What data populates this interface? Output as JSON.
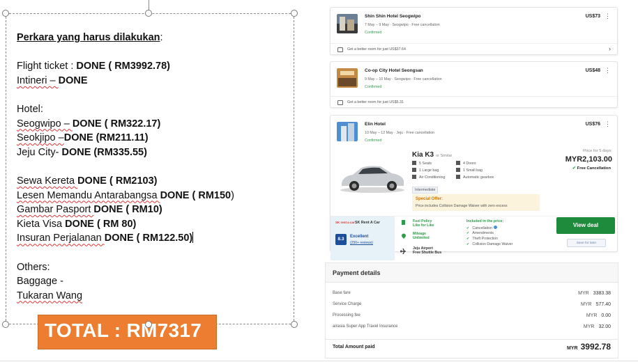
{
  "doc": {
    "heading": "Perkara yang harus dilakukan",
    "lines": [
      {
        "label": "Flight ticket : ",
        "bold": "DONE ( RM3992.78)"
      },
      {
        "label": "Intineri – ",
        "bold": "DONE"
      },
      {
        "label": "Hotel:"
      },
      {
        "label": "Seogwipo – ",
        "bold": "DONE ( RM322.17)"
      },
      {
        "label": "Seokjipo –",
        "bold": "DONE (RM211.11)"
      },
      {
        "label": "Jeju City- ",
        "bold": "DONE (RM335.55)"
      },
      {
        "label": "Sewa Kereta ",
        "bold": "DONE ( RM2103)"
      },
      {
        "label": "Lesen Memandu Antarabangsa ",
        "bold": "DONE ( RM150",
        "tail": ")"
      },
      {
        "label": "Gambar Pasport ",
        "bold": "DONE ( RM10)"
      },
      {
        "label": "Kieta Visa ",
        "bold": "DONE ( RM 80)"
      },
      {
        "label": "Insuran Perjalanan ",
        "bold": "DONE ( RM122.50)"
      },
      {
        "label": "Others:"
      },
      {
        "label": "Baggage -"
      },
      {
        "label": "Tukaran Wang"
      }
    ],
    "total": "TOTAL : RM7317"
  },
  "hotels": [
    {
      "name": "Shin Shin Hotel Seogwipo",
      "dates": "7 May – 9 May · Seogwipo · Free cancellation",
      "status": "Confirmed",
      "price": "US$73",
      "upsell": "Get a better room for just US$37.64"
    },
    {
      "name": "Co-op City Hotel Seongsan",
      "dates": "9 May – 10 May · Seogwipo · Free cancellation",
      "status": "Confirmed",
      "price": "US$48",
      "upsell": "Get a better room for just US$5.31"
    },
    {
      "name": "Elin Hotel",
      "dates": "10 May – 12 May · Jeju · Free cancellation",
      "status": "Confirmed",
      "price": "US$76"
    }
  ],
  "car": {
    "name": "Kia K3",
    "similar": "or Similar",
    "specs": [
      "5 Seats",
      "4 Doors",
      "1 Large bag",
      "1 Small bag",
      "Air Conditioning",
      "Automatic gearbox"
    ],
    "category": "Intermediate",
    "special_title": "Special Offer:",
    "special_body": "Price includes Collision Damage Waiver with zero excess",
    "price_for": "Price for 5 days:",
    "price": "MYR2,103.00",
    "free_cancel": "Free Cancellation",
    "supplier_logo": "SK rent a car",
    "supplier": "SK Rent A Car",
    "score": "8.3",
    "score_label": "Excellent",
    "reviews": "(250+ reviews)",
    "fuel_title": "Fuel Policy",
    "fuel_value": "Like for Like",
    "mileage_title": "Mileage",
    "mileage_value": "Unlimited",
    "pickup_title": "Jeju Airport",
    "pickup_value": "Free Shuttle Bus",
    "included_title": "Included in the price:",
    "included": [
      "Cancellation",
      "Amendments",
      "Theft Protection",
      "Collision Damage Waiver"
    ],
    "view_deal": "View deal",
    "save_later": "Save for later"
  },
  "payment": {
    "title": "Payment details",
    "rows": [
      {
        "label": "Base fare",
        "cur": "MYR",
        "value": "3383.38"
      },
      {
        "label": "Service Charge",
        "cur": "MYR",
        "value": "577.40"
      },
      {
        "label": "Processing fee",
        "cur": "MYR",
        "value": "0.00"
      },
      {
        "label": "airasia Super App Travel Insurance",
        "cur": "MYR",
        "value": "32.00"
      }
    ],
    "total_label": "Total Amount paid",
    "total_cur": "MYR",
    "total_value": "3992.78"
  }
}
